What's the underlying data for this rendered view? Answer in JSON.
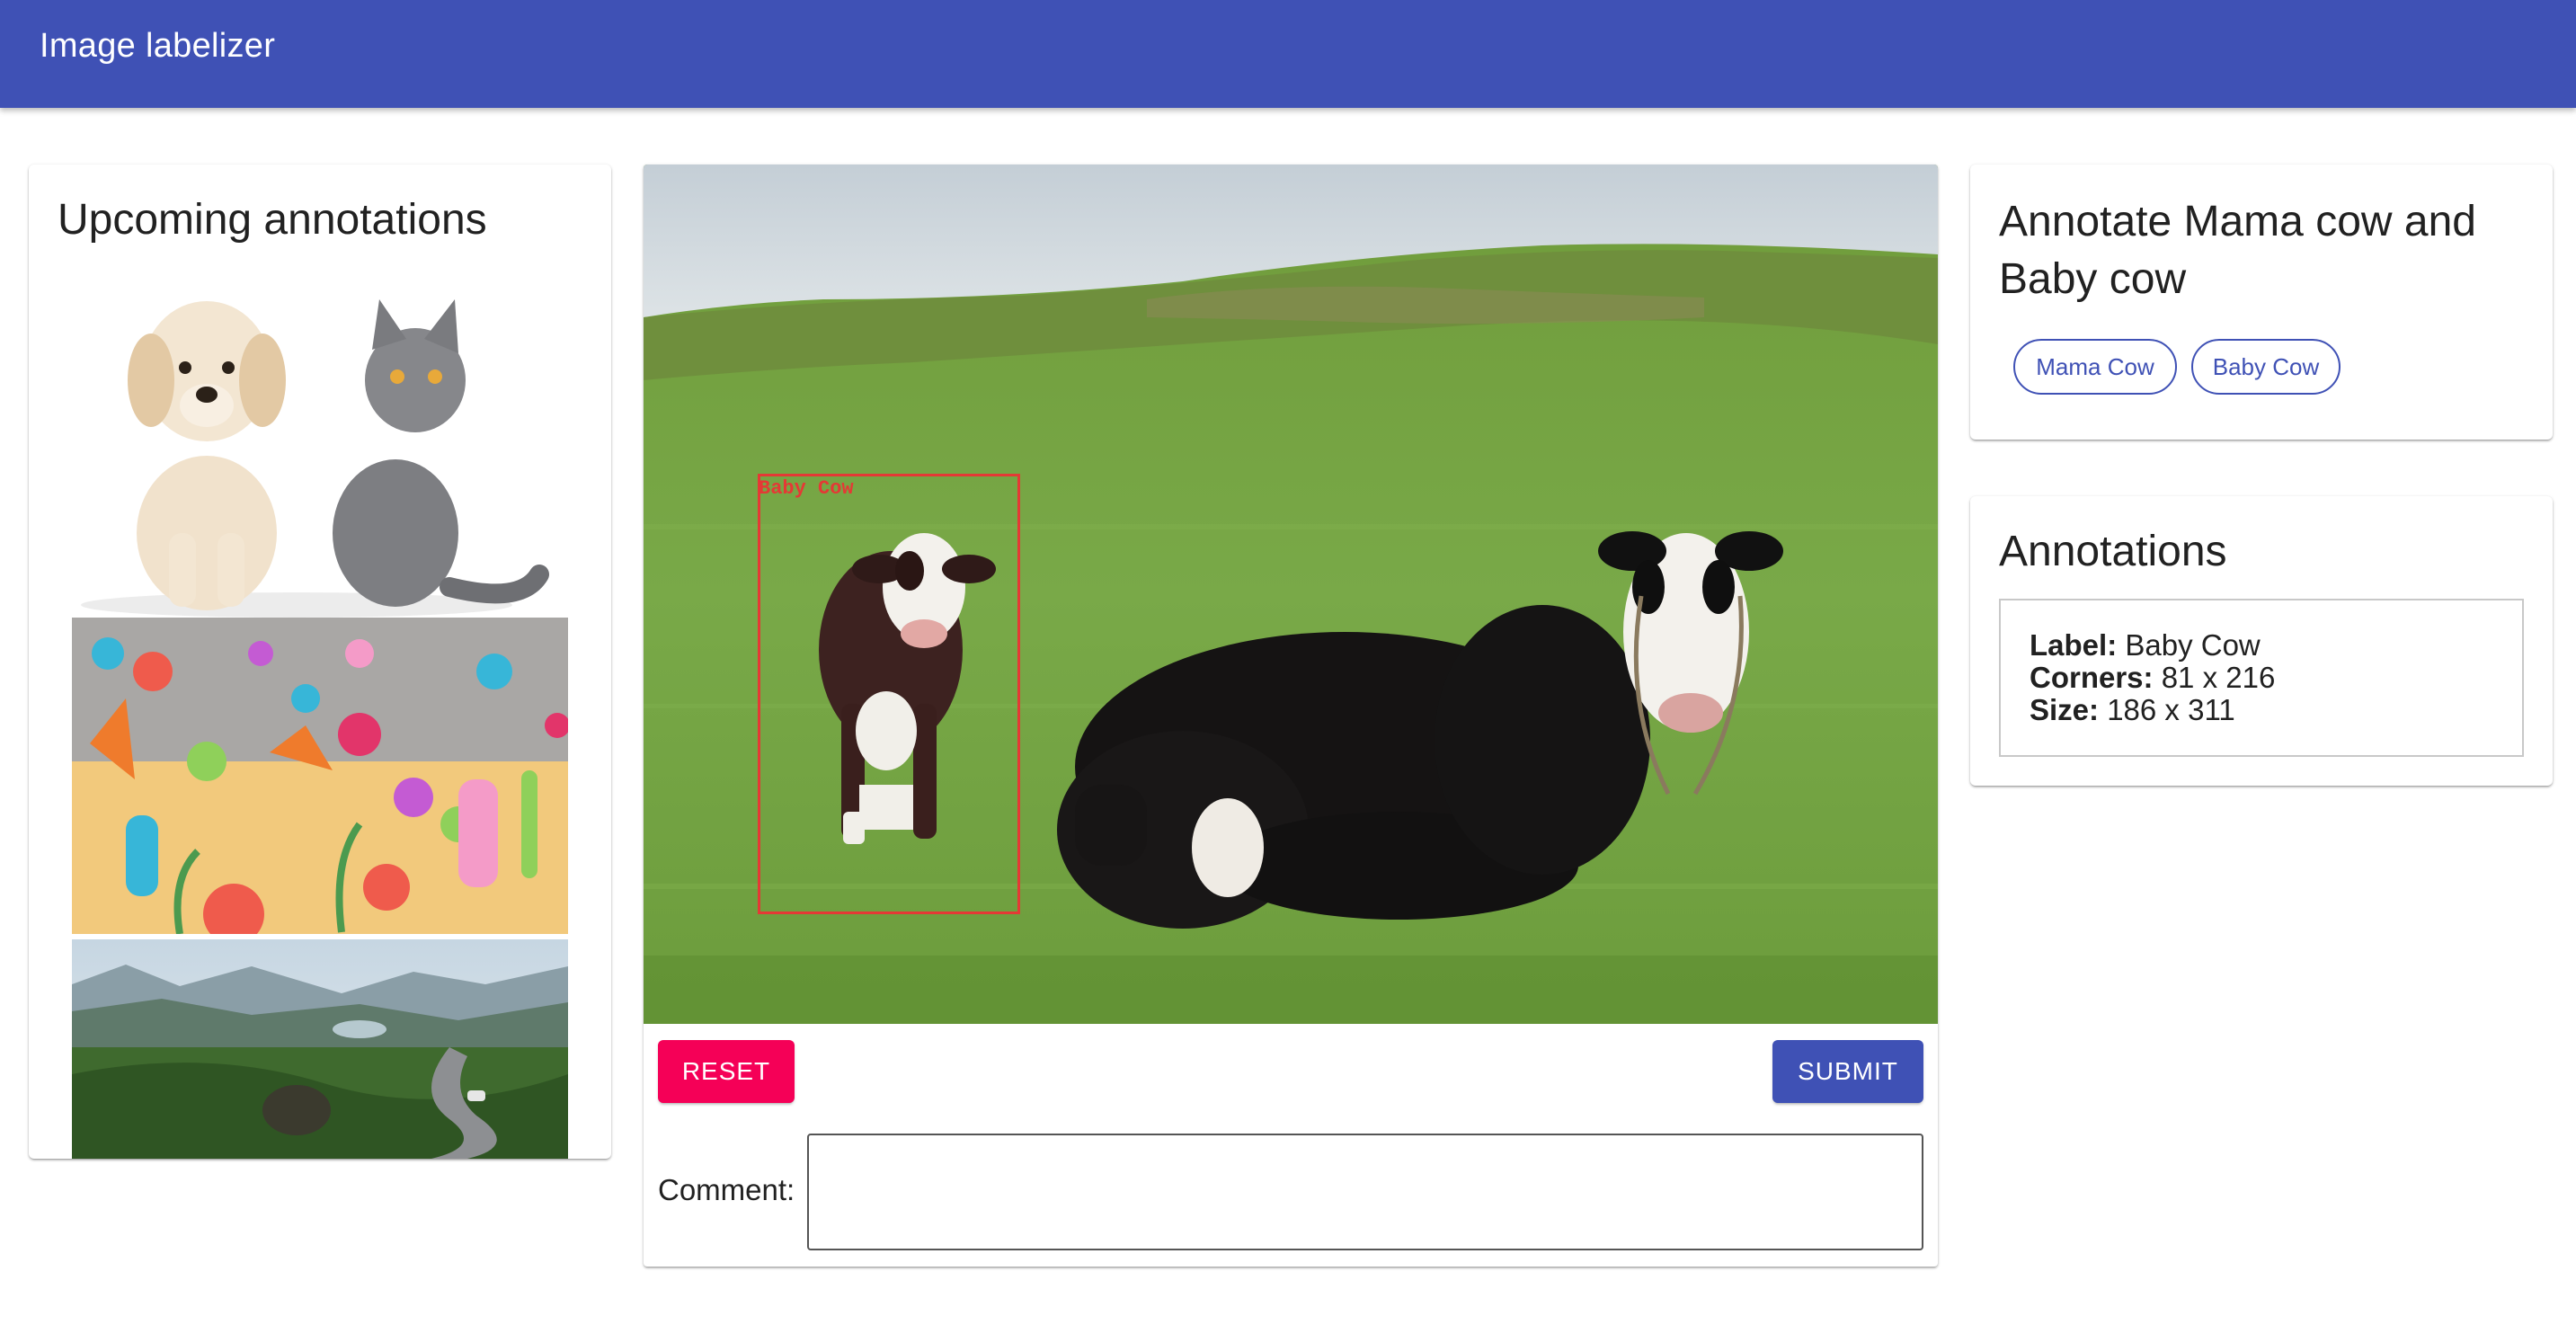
{
  "app": {
    "title": "Image labelizer",
    "accent_color": "#3f51b5",
    "secondary_color": "#f50057"
  },
  "upcoming": {
    "title": "Upcoming annotations",
    "thumbnails": [
      "puppy-and-cat-image",
      "ocean-creatures-illustration",
      "mountain-road-landscape"
    ]
  },
  "canvas": {
    "box_label": "Baby Cow",
    "box_color": "#e53935"
  },
  "actions": {
    "reset_label": "RESET",
    "submit_label": "SUBMIT"
  },
  "comment": {
    "label": "Comment:",
    "value": ""
  },
  "task": {
    "title": "Annotate Mama cow and Baby cow",
    "labels": [
      "Mama Cow",
      "Baby Cow"
    ]
  },
  "annotations": {
    "title": "Annotations",
    "items": [
      {
        "label_key": "Label:",
        "label": "Baby Cow",
        "corners_key": "Corners:",
        "corners": "81 x 216",
        "size_key": "Size:",
        "size": "186 x 311"
      }
    ]
  }
}
